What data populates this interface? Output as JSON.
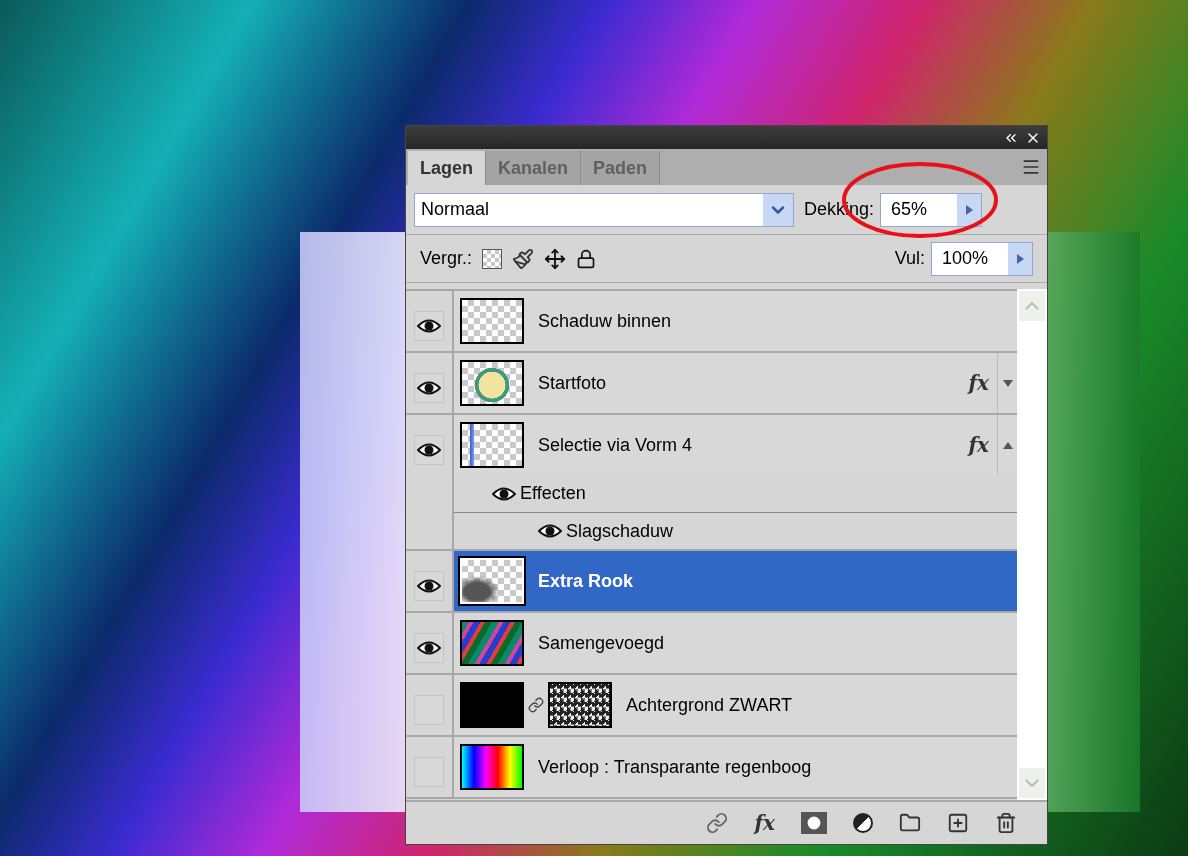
{
  "panel": {
    "tabs": [
      {
        "label": "Lagen",
        "selected": true
      },
      {
        "label": "Kanalen",
        "selected": false
      },
      {
        "label": "Paden",
        "selected": false
      }
    ],
    "blend_mode": "Normaal",
    "opacity": {
      "label": "Dekking:",
      "value": "65%"
    },
    "lock_label": "Vergr.:",
    "fill": {
      "label": "Vul:",
      "value": "100%"
    },
    "layers": [
      {
        "name": "Schaduw binnen",
        "visible": true,
        "selected": false,
        "thumbnail": {
          "kind": "transparent"
        }
      },
      {
        "name": "Startfoto",
        "visible": true,
        "selected": false,
        "thumbnail": {
          "kind": "photo"
        },
        "effects": {
          "label": "fx",
          "expanded": false
        }
      },
      {
        "name": "Selectie via Vorm 4",
        "visible": true,
        "selected": false,
        "thumbnail": {
          "kind": "stroke"
        },
        "effects": {
          "label": "fx",
          "expanded": true,
          "items": [
            {
              "name": "Effecten",
              "visible": true,
              "children": [
                {
                  "name": "Slagschaduw",
                  "visible": true
                }
              ]
            }
          ]
        }
      },
      {
        "name": "Extra Rook",
        "visible": true,
        "selected": true,
        "thumbnail": {
          "kind": "smoke"
        }
      },
      {
        "name": "Samengevoegd",
        "visible": true,
        "selected": false,
        "thumbnail": {
          "kind": "streaks"
        }
      },
      {
        "name": "Achtergrond ZWART",
        "visible": false,
        "selected": false,
        "thumbnail": {
          "kind": "black"
        },
        "mask": {
          "kind": "noise"
        }
      },
      {
        "name": "Verloop : Transparante regenboog",
        "visible": false,
        "selected": false,
        "thumbnail": {
          "kind": "rainbow"
        }
      }
    ],
    "toolbar": {
      "fx_label": "fx"
    }
  }
}
